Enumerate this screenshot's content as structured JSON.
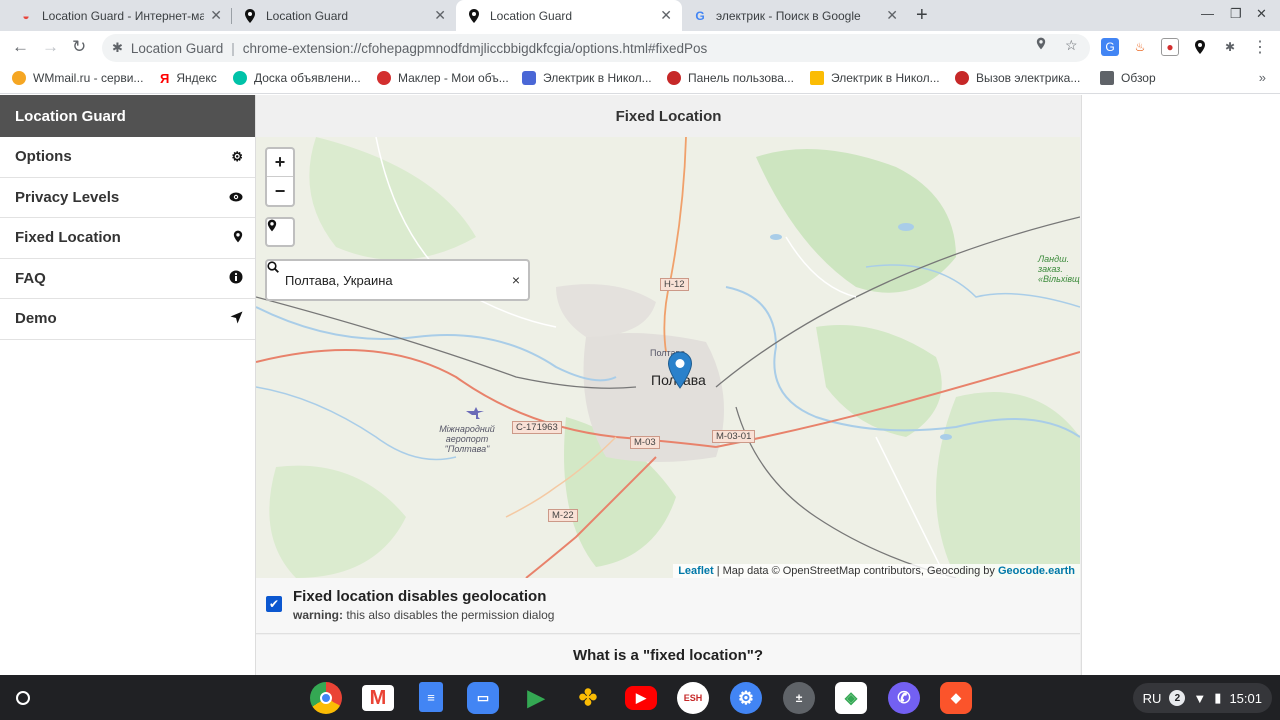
{
  "tabs": [
    {
      "title": "Location Guard - Интернет-маг",
      "active": false
    },
    {
      "title": "Location Guard",
      "active": false
    },
    {
      "title": "Location Guard",
      "active": true
    },
    {
      "title": "электрик - Поиск в Google",
      "active": false
    }
  ],
  "omnibox": {
    "origin": "Location Guard",
    "divider": "|",
    "url": "chrome-extension://cfohepagpmnodfdmjliccbbigdkfcgia/options.html#fixedPos"
  },
  "bookmarks": [
    {
      "label": "WMmail.ru - серви...",
      "color": "#f5a623"
    },
    {
      "label": "Яндекс",
      "color": "#ff0000"
    },
    {
      "label": "Доска объявлени...",
      "color": "#00c2a8"
    },
    {
      "label": "Маклер - Мои объ...",
      "color": "#d32f2f"
    },
    {
      "label": "Электрик в Никол...",
      "color": "#4a67d6"
    },
    {
      "label": "Панель пользова...",
      "color": "#c62828"
    },
    {
      "label": "Электрик в Никол...",
      "color": "#fbbc04"
    },
    {
      "label": "Вызов электрика...",
      "color": "#c62828"
    },
    {
      "label": "Обзор",
      "color": "#5f6368"
    }
  ],
  "sidebar": {
    "header": "Location Guard",
    "items": [
      {
        "label": "Options",
        "icon": "gear-icon"
      },
      {
        "label": "Privacy Levels",
        "icon": "eye-icon"
      },
      {
        "label": "Fixed Location",
        "icon": "map-pin-icon"
      },
      {
        "label": "FAQ",
        "icon": "info-icon"
      },
      {
        "label": "Demo",
        "icon": "location-arrow-icon"
      }
    ]
  },
  "content": {
    "title": "Fixed Location",
    "map": {
      "zoom_in": "+",
      "zoom_out": "−",
      "search_value": "Полтава, Украина",
      "clear": "×",
      "attribution_leaflet": "Leaflet",
      "attribution_text": "| Map data © OpenStreetMap contributors, Geocoding by",
      "attribution_geocode": "Geocode.earth",
      "city": "Полтава",
      "city_small": "Полтава",
      "airport": "Міжнародний аеропорт \"Полтава\"",
      "landscape": "Ландш. заказ. «Вільхівщ",
      "roads": [
        "Н-12",
        "С-171963",
        "М-03",
        "М-03-01",
        "М-22"
      ]
    },
    "option": {
      "checked": true,
      "title": "Fixed location disables geolocation",
      "warn_label": "warning:",
      "warn_text": "this also disables the permission dialog"
    },
    "faq_question": "What is a \"fixed location\"?"
  },
  "shelf": {
    "tray_lang": "RU",
    "tray_badge": "2",
    "time": "15:01"
  }
}
